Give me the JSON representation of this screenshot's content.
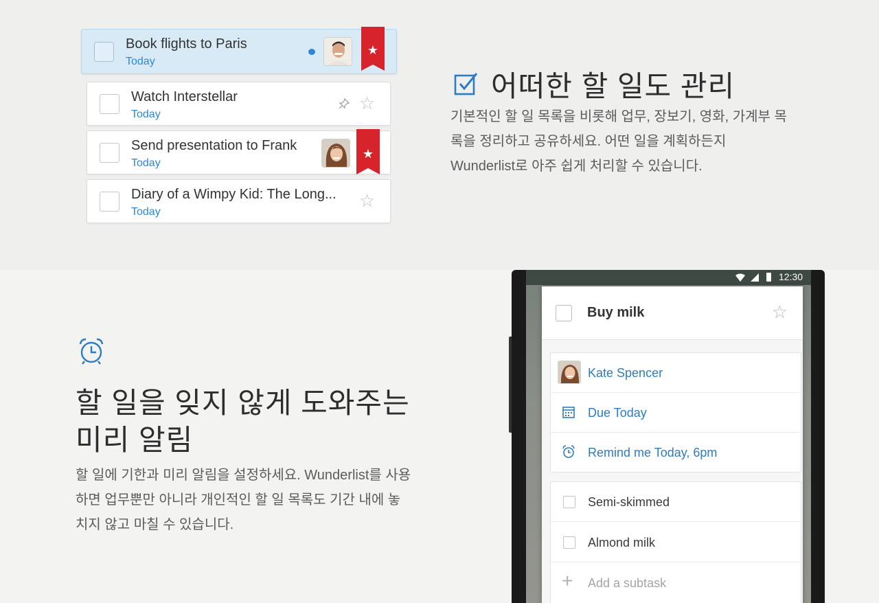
{
  "tasks": [
    {
      "title": "Book flights to Paris",
      "due": "Today"
    },
    {
      "title": "Watch Interstellar",
      "due": "Today"
    },
    {
      "title": "Send presentation to Frank",
      "due": "Today"
    },
    {
      "title": "Diary of a Wimpy Kid: The Long...",
      "due": "Today"
    }
  ],
  "section1": {
    "heading": "어떠한 할 일도 관리",
    "body_lines": [
      "기본적인 할 일 목록을 비롯해 업무, 장보기, 영화, 가계부 목",
      "록을 정리하고 공유하세요. 어떤 일을 계획하든지",
      "Wunderlist로 아주 쉽게 처리할 수 있습니다."
    ]
  },
  "section2": {
    "heading_lines": [
      "할 일을 잊지 않게 도와주는",
      "미리 알림"
    ],
    "body_lines": [
      "할 일에 기한과 미리 알림을 설정하세요. Wunderlist를 사용",
      "하면 업무뿐만 아니라 개인적인 할 일 목록도 기간 내에 놓",
      "치지 않고 마칠 수 있습니다."
    ]
  },
  "phone": {
    "status_time": "12:30",
    "task_title": "Buy milk",
    "assignee": "Kate Spencer",
    "due": "Due Today",
    "reminder": "Remind me Today, 6pm",
    "subtasks": [
      "Semi-skimmed",
      "Almond milk"
    ],
    "add_subtask_placeholder": "Add a subtask"
  },
  "colors": {
    "accent": "#2b88d9",
    "ribbon": "#d7242c",
    "selected_bg": "#d9eaf7"
  },
  "icons": [
    "checkbox-icon",
    "alarm-clock-icon",
    "star-icon",
    "pin-icon",
    "comment-icon",
    "calendar-icon",
    "plus-icon"
  ]
}
